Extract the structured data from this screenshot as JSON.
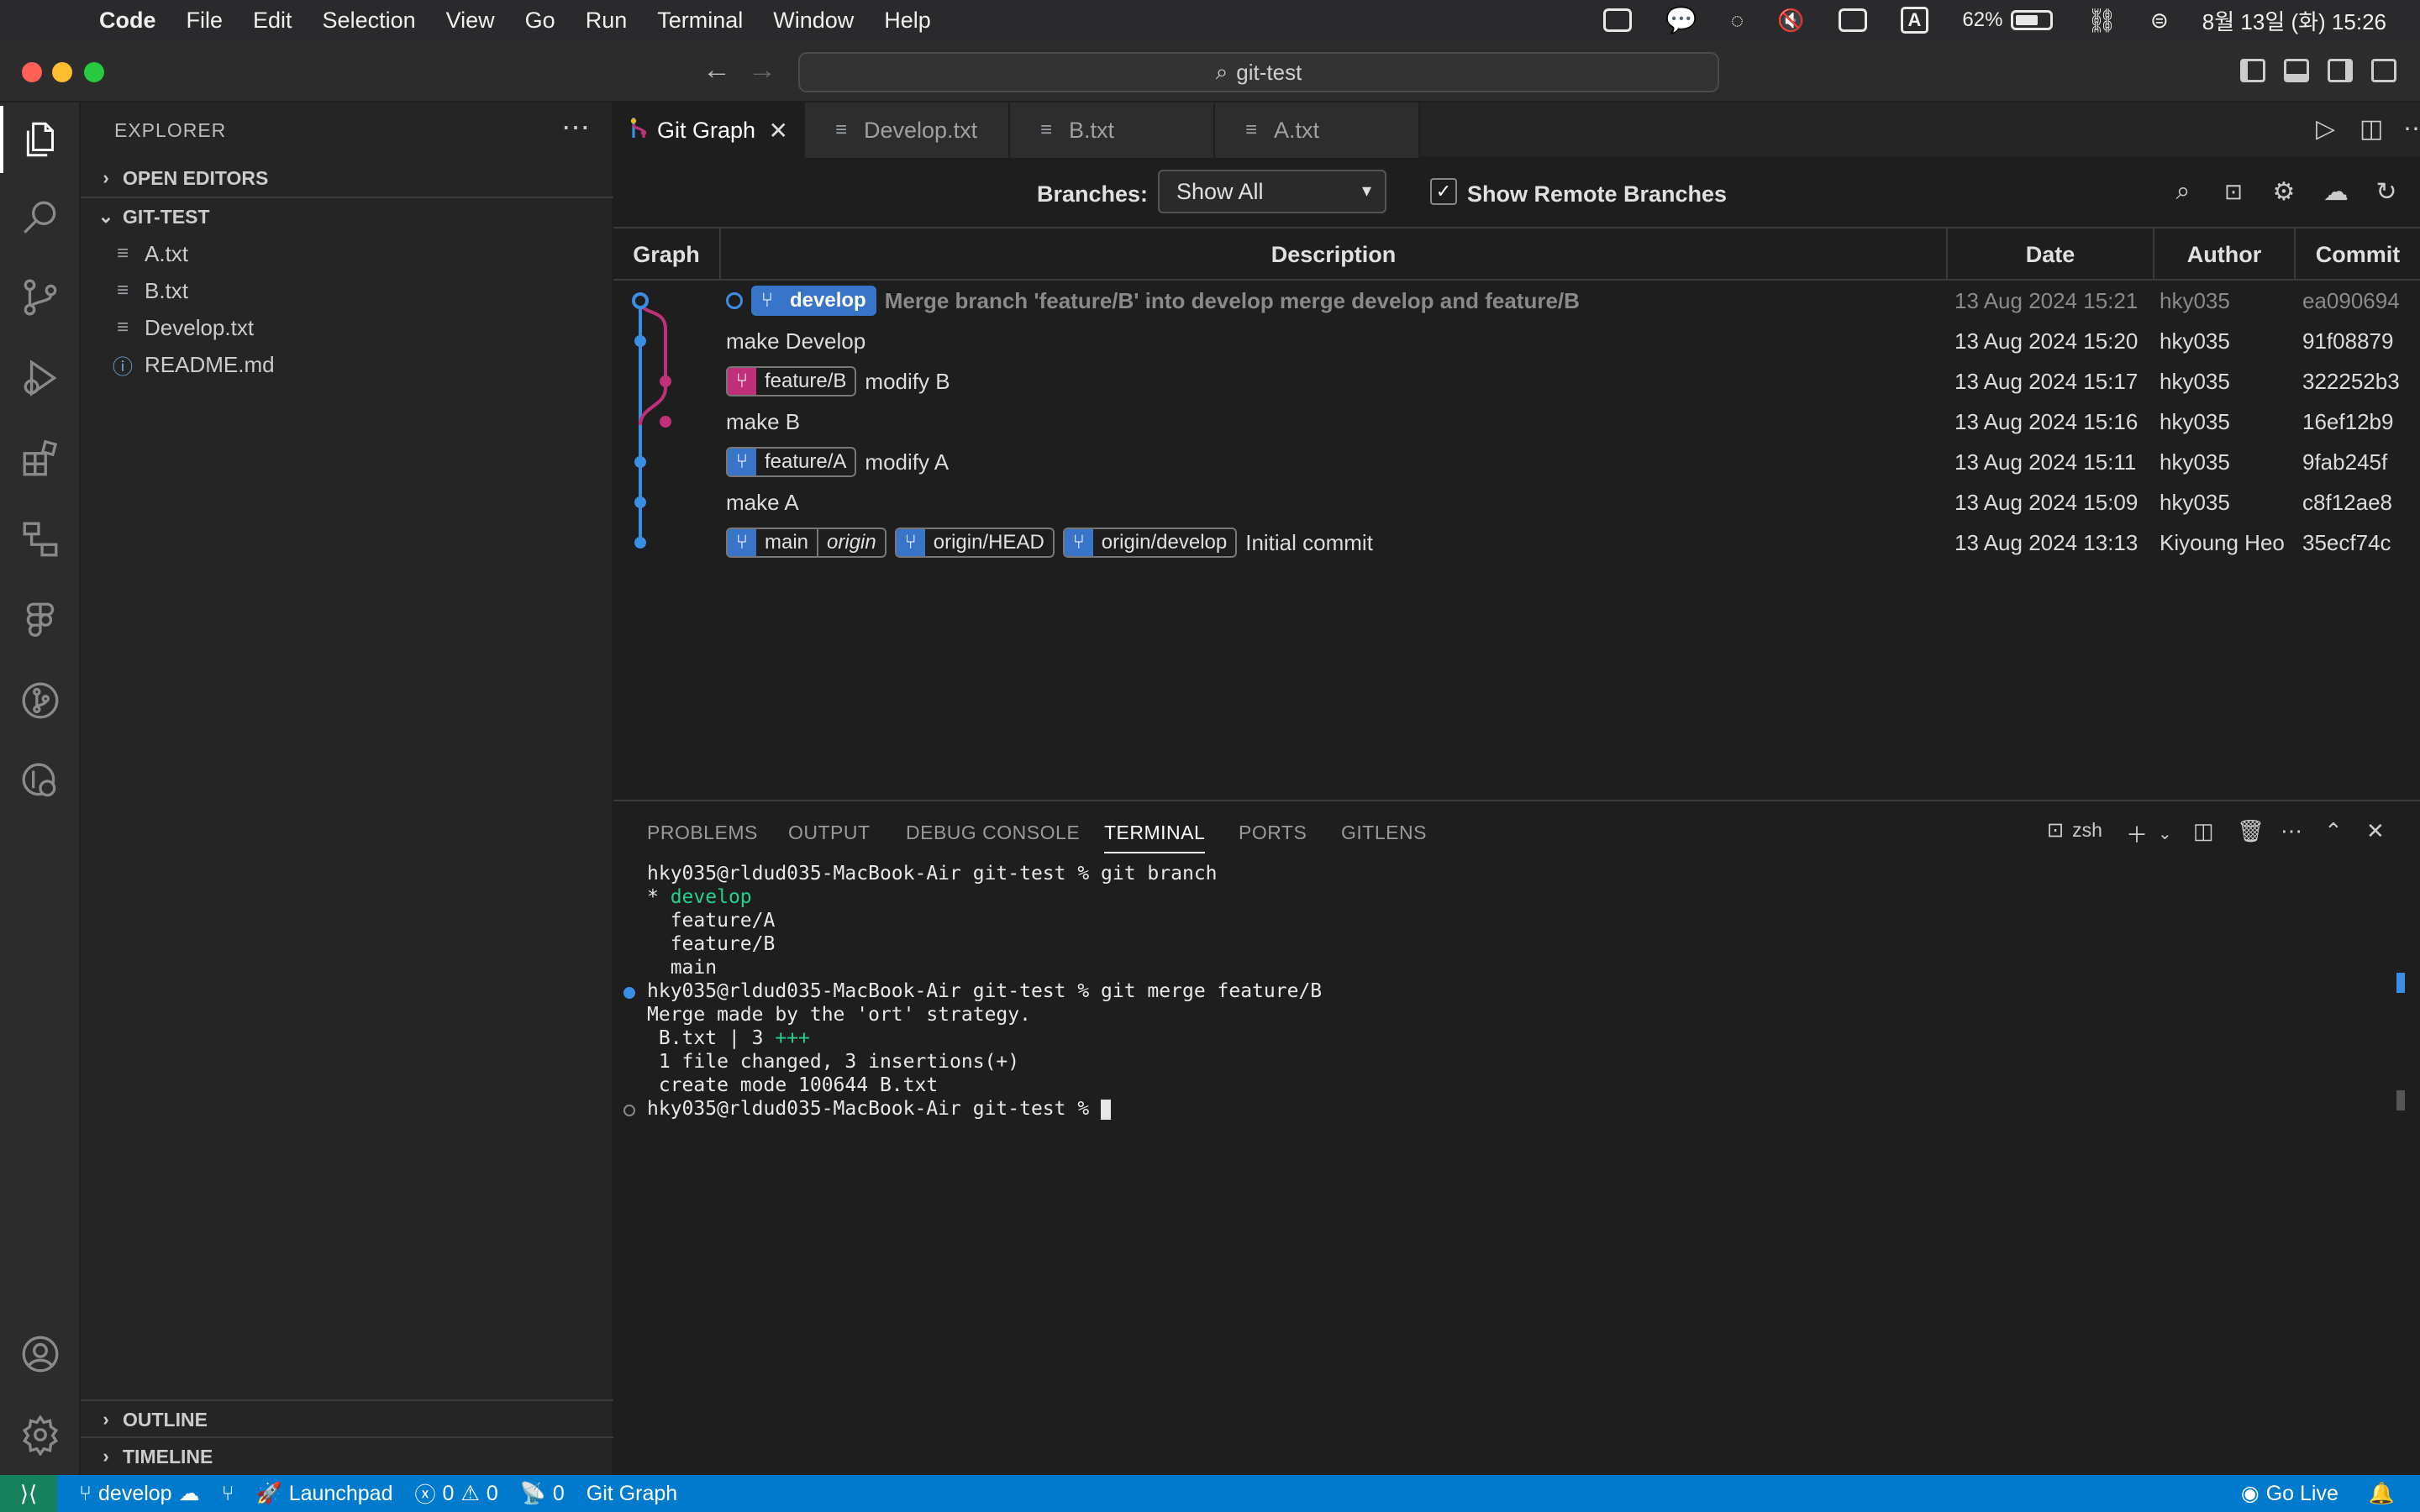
{
  "menubar": {
    "app": "Code",
    "items": [
      "File",
      "Edit",
      "Selection",
      "View",
      "Go",
      "Run",
      "Terminal",
      "Window",
      "Help"
    ],
    "battery": "62%",
    "datetime": "8월 13일 (화) 15:26",
    "input_source": "A"
  },
  "window": {
    "search_text": "git-test"
  },
  "activity_bar": [
    "explorer-icon",
    "search-icon",
    "source-control-icon",
    "run-debug-icon",
    "extensions-icon",
    "remote-explorer-icon",
    "figma-icon",
    "git-graph-icon",
    "gitlens-icon",
    "account-icon",
    "settings-gear-icon"
  ],
  "sidebar": {
    "title": "EXPLORER",
    "open_editors": "OPEN EDITORS",
    "folder": "GIT-TEST",
    "files": [
      {
        "name": "A.txt",
        "icon": "lines-icon"
      },
      {
        "name": "B.txt",
        "icon": "lines-icon"
      },
      {
        "name": "Develop.txt",
        "icon": "lines-icon"
      },
      {
        "name": "README.md",
        "icon": "info-icon"
      }
    ],
    "outline": "OUTLINE",
    "timeline": "TIMELINE"
  },
  "tabs": [
    {
      "label": "Git Graph",
      "active": true
    },
    {
      "label": "Develop.txt"
    },
    {
      "label": "B.txt"
    },
    {
      "label": "A.txt"
    }
  ],
  "git_graph": {
    "branches_label": "Branches:",
    "branches_value": "Show All",
    "show_remote_label": "Show Remote Branches",
    "show_remote_checked": true,
    "columns": [
      "Graph",
      "Description",
      "Date",
      "Author",
      "Commit"
    ],
    "commits": [
      {
        "refs": [
          {
            "name": "develop",
            "head": true
          }
        ],
        "message": "Merge branch 'feature/B' into develop merge develop and feature/B",
        "date": "13 Aug 2024 15:21",
        "author": "hky035",
        "hash": "ea090694",
        "dim": true
      },
      {
        "refs": [],
        "message": "make Develop",
        "date": "13 Aug 2024 15:20",
        "author": "hky035",
        "hash": "91f08879"
      },
      {
        "refs": [
          {
            "name": "feature/B",
            "color": "#c0307a"
          }
        ],
        "message": "modify B",
        "date": "13 Aug 2024 15:17",
        "author": "hky035",
        "hash": "322252b3"
      },
      {
        "refs": [],
        "message": "make B",
        "date": "13 Aug 2024 15:16",
        "author": "hky035",
        "hash": "16ef12b9"
      },
      {
        "refs": [
          {
            "name": "feature/A",
            "color": "#3874c8"
          }
        ],
        "message": "modify A",
        "date": "13 Aug 2024 15:11",
        "author": "hky035",
        "hash": "9fab245f"
      },
      {
        "refs": [],
        "message": "make A",
        "date": "13 Aug 2024 15:09",
        "author": "hky035",
        "hash": "c8f12ae8"
      },
      {
        "refs": [
          {
            "name": "main",
            "remote": "origin",
            "color": "#3874c8"
          },
          {
            "name": "origin/HEAD",
            "color": "#3874c8"
          },
          {
            "name": "origin/develop",
            "color": "#3874c8"
          }
        ],
        "message": "Initial commit",
        "date": "13 Aug 2024 13:13",
        "author": "Kiyoung Heo",
        "hash": "35ecf74c"
      }
    ]
  },
  "panel": {
    "tabs": [
      "PROBLEMS",
      "OUTPUT",
      "DEBUG CONSOLE",
      "TERMINAL",
      "PORTS",
      "GITLENS"
    ],
    "active_tab": "TERMINAL",
    "shell": "zsh",
    "terminal_lines": [
      "hky035@rldud035-MacBook-Air git-test % git branch",
      "* develop",
      "  feature/A",
      "  feature/B",
      "  main",
      "hky035@rldud035-MacBook-Air git-test % git merge feature/B",
      "Merge made by the 'ort' strategy.",
      " B.txt | 3 +++",
      " 1 file changed, 3 insertions(+)",
      " create mode 100644 B.txt",
      "hky035@rldud035-MacBook-Air git-test % "
    ]
  },
  "statusbar": {
    "branch": "develop",
    "launchpad": "Launchpad",
    "errors": "0",
    "warnings": "0",
    "ports": "0",
    "git_graph": "Git Graph",
    "go_live": "Go Live"
  },
  "colors": {
    "accent": "#007acc",
    "branch_blue": "#3a8ee6",
    "branch_pink": "#c0307a",
    "terminal_green": "#23d18b"
  }
}
